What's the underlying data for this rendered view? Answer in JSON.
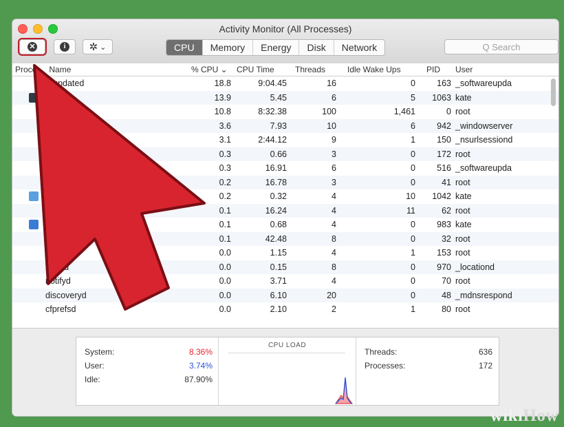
{
  "window": {
    "title": "Activity Monitor (All Processes)"
  },
  "toolbar": {
    "tabs": [
      "CPU",
      "Memory",
      "Energy",
      "Disk",
      "Network"
    ],
    "active_tab": "CPU",
    "search_placeholder": "Q Search",
    "gear_caret": "⌄"
  },
  "table": {
    "headers": {
      "process": "Proce",
      "name_suffix": "Name",
      "cpu": "% CPU ⌄",
      "cpu_time": "CPU Time",
      "threads": "Threads",
      "idle": "Idle Wake Ups",
      "pid": "PID",
      "user": "User"
    },
    "rows": [
      {
        "name": "roupdated",
        "cpu": "18.8",
        "time": "9:04.45",
        "threads": "16",
        "idle": "0",
        "pid": "163",
        "user": "_softwareupda"
      },
      {
        "name": "onitor",
        "cpu": "13.9",
        "time": "5.45",
        "threads": "6",
        "idle": "5",
        "pid": "1063",
        "user": "kate"
      },
      {
        "name": "",
        "cpu": "10.8",
        "time": "8:32.38",
        "threads": "100",
        "idle": "1,461",
        "pid": "0",
        "user": "root"
      },
      {
        "name": "",
        "cpu": "3.6",
        "time": "7.93",
        "threads": "10",
        "idle": "6",
        "pid": "942",
        "user": "_windowserver"
      },
      {
        "name": "",
        "cpu": "3.1",
        "time": "2:44.12",
        "threads": "9",
        "idle": "1",
        "pid": "150",
        "user": "_nsurlsessiond"
      },
      {
        "name": "",
        "cpu": "0.3",
        "time": "0.66",
        "threads": "3",
        "idle": "0",
        "pid": "172",
        "user": "root"
      },
      {
        "name": "",
        "cpu": "0.3",
        "time": "16.91",
        "threads": "6",
        "idle": "0",
        "pid": "516",
        "user": "_softwareupda"
      },
      {
        "name": "",
        "cpu": "0.2",
        "time": "16.78",
        "threads": "3",
        "idle": "0",
        "pid": "41",
        "user": "root"
      },
      {
        "name": "",
        "cpu": "0.2",
        "time": "0.32",
        "threads": "4",
        "idle": "10",
        "pid": "1042",
        "user": "kate"
      },
      {
        "name": "",
        "cpu": "0.1",
        "time": "16.24",
        "threads": "4",
        "idle": "11",
        "pid": "62",
        "user": "root"
      },
      {
        "name": "",
        "cpu": "0.1",
        "time": "0.68",
        "threads": "4",
        "idle": "0",
        "pid": "983",
        "user": "kate"
      },
      {
        "name": "",
        "cpu": "0.1",
        "time": "42.48",
        "threads": "8",
        "idle": "0",
        "pid": "32",
        "user": "root"
      },
      {
        "name": "",
        "cpu": "0.0",
        "time": "1.15",
        "threads": "4",
        "idle": "1",
        "pid": "153",
        "user": "root"
      },
      {
        "name": "ationd",
        "cpu": "0.0",
        "time": "0.15",
        "threads": "8",
        "idle": "0",
        "pid": "970",
        "user": "_locationd"
      },
      {
        "name": "notifyd",
        "cpu": "0.0",
        "time": "3.71",
        "threads": "4",
        "idle": "0",
        "pid": "70",
        "user": "root"
      },
      {
        "name": "discoveryd",
        "cpu": "0.0",
        "time": "6.10",
        "threads": "20",
        "idle": "0",
        "pid": "48",
        "user": "_mdnsrespond"
      },
      {
        "name": "cfprefsd",
        "cpu": "0.0",
        "time": "2.10",
        "threads": "2",
        "idle": "1",
        "pid": "80",
        "user": "root"
      }
    ]
  },
  "summary": {
    "system_label": "System:",
    "system_value": "8.36%",
    "system_color": "#e0282f",
    "user_label": "User:",
    "user_value": "3.74%",
    "user_color": "#2a52d6",
    "idle_label": "Idle:",
    "idle_value": "87.90%",
    "cpu_load_label": "CPU LOAD",
    "threads_label": "Threads:",
    "threads_value": "636",
    "processes_label": "Processes:",
    "processes_value": "172"
  },
  "annotation": {
    "arrow_color": "#d8242e"
  },
  "watermark": {
    "wiki": "wiki",
    "how": "How"
  }
}
